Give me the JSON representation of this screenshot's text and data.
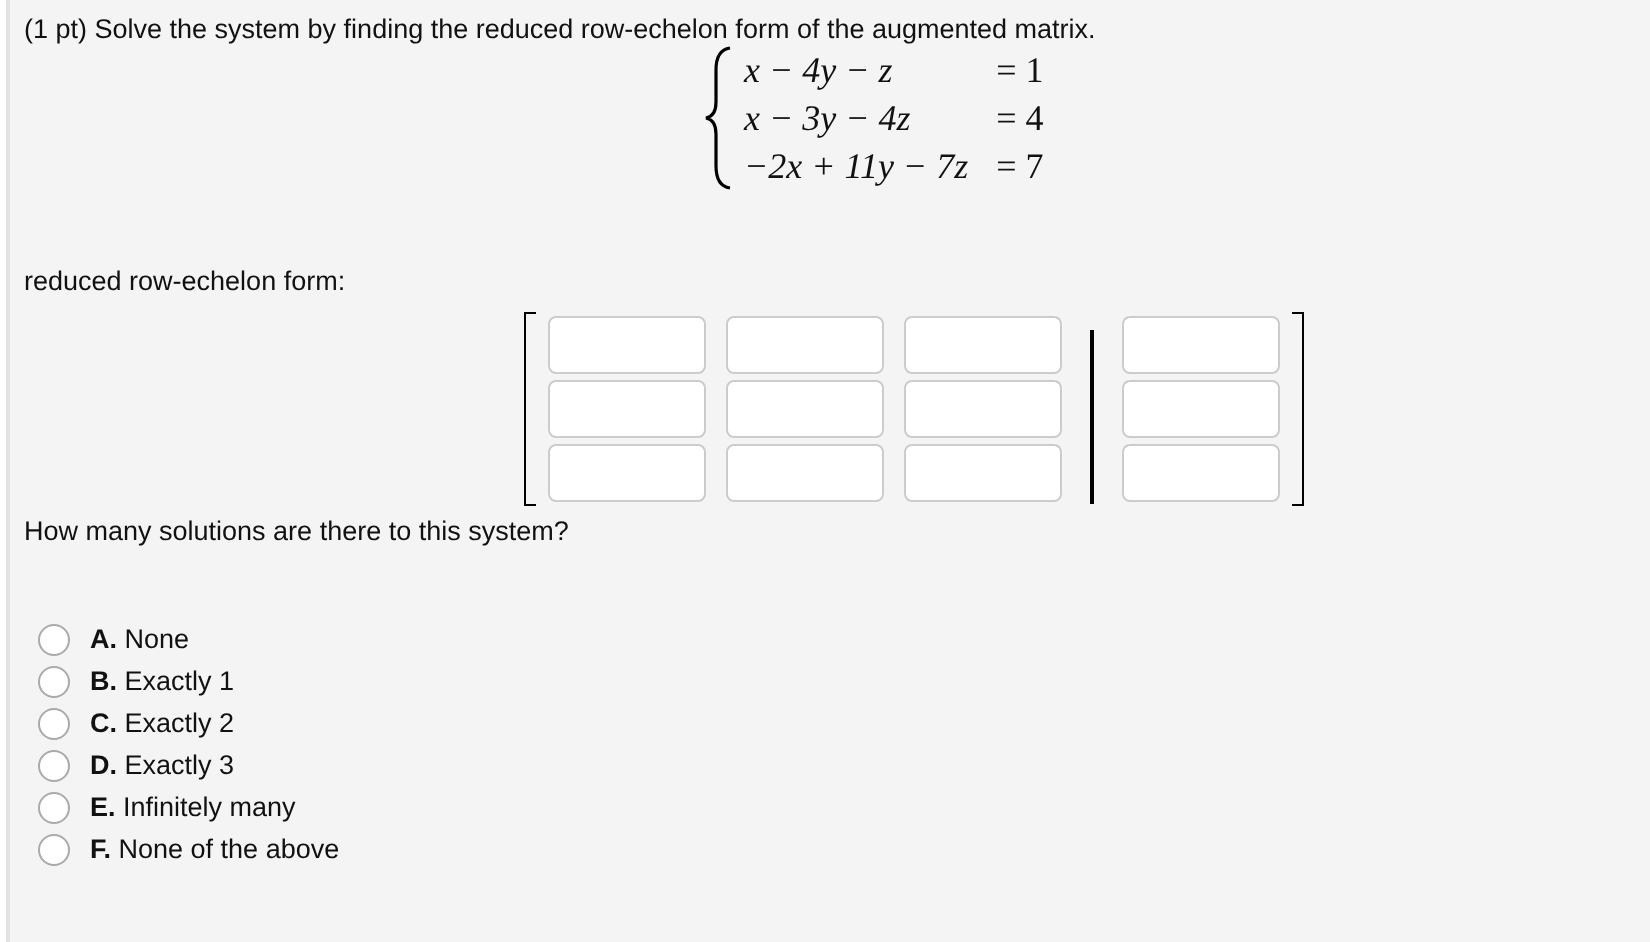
{
  "problem": {
    "prompt": "(1 pt) Solve the system by finding the reduced row-echelon form of the augmented matrix.",
    "equations": [
      {
        "lhs": "x − 4y − z",
        "rhs": "= 1"
      },
      {
        "lhs": "x − 3y − 4z",
        "rhs": "= 4"
      },
      {
        "lhs": "−2x + 11y − 7z",
        "rhs": "= 7"
      }
    ],
    "matrix_label": "reduced row-echelon form:",
    "matrix": [
      [
        {
          "kind": "coefficient"
        },
        {
          "kind": "coefficient"
        },
        {
          "kind": "coefficient"
        },
        {
          "kind": "constant"
        }
      ],
      [
        {
          "kind": "coefficient"
        },
        {
          "kind": "coefficient"
        },
        {
          "kind": "coefficient"
        },
        {
          "kind": "constant"
        }
      ],
      [
        {
          "kind": "coefficient"
        },
        {
          "kind": "coefficient"
        },
        {
          "kind": "coefficient"
        },
        {
          "kind": "constant"
        }
      ]
    ],
    "question": "How many solutions are there to this system?",
    "options": [
      {
        "text": "**A.** None",
        "selected": false
      },
      {
        "text": "**B.** Exactly 1",
        "selected": false
      },
      {
        "text": "**C.** Exactly 2",
        "selected": false
      },
      {
        "text": "**D.** Exactly 3",
        "selected": false
      },
      {
        "text": "**E.** Infinitely many",
        "selected": false
      },
      {
        "text": "**F.** None of the above",
        "selected": false
      }
    ]
  }
}
